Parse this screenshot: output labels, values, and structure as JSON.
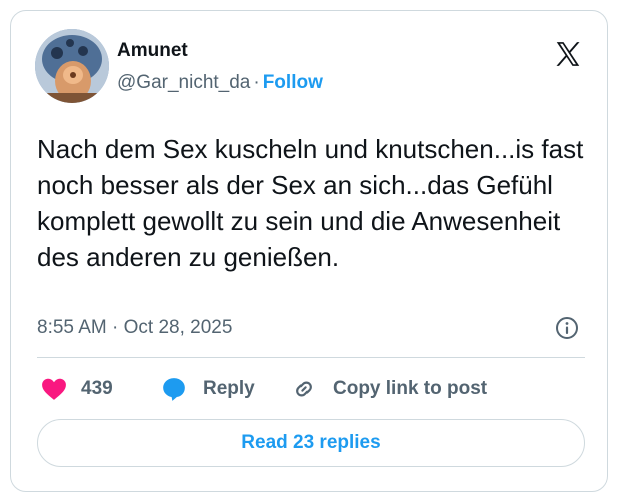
{
  "author": {
    "name": "Amunet",
    "handle": "@Gar_nicht_da",
    "separator": "·",
    "follow_label": "Follow"
  },
  "tweet": {
    "text": "Nach dem Sex kuscheln und knutschen...is fast noch besser als der Sex an sich...das Gefühl komplett gewollt zu sein und die Anwesenheit des anderen zu genießen.",
    "time": "8:55 AM",
    "date_separator": "·",
    "date": "Oct 28, 2025"
  },
  "actions": {
    "like_count": "439",
    "reply_label": "Reply",
    "copy_label": "Copy link to post"
  },
  "read_replies_label": "Read 23 replies",
  "icons": {
    "brand": "x-logo-icon",
    "info": "info-icon",
    "like": "heart-icon",
    "reply": "speech-bubble-icon",
    "copy": "link-icon"
  },
  "colors": {
    "accent": "#1d9bf0",
    "like": "#f91880",
    "text": "#0f1419",
    "muted": "#536471",
    "border": "#cfd9de"
  }
}
